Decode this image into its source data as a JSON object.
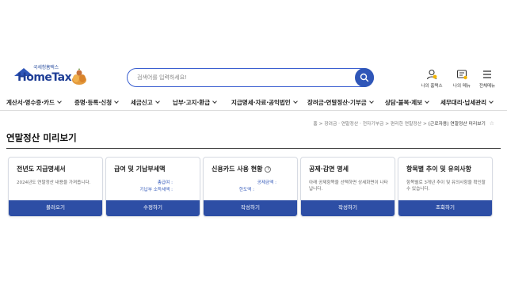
{
  "logo": {
    "sub": "국세청홈택스",
    "main": "HomeTax"
  },
  "search": {
    "placeholder": "검색어를 입력하세요!"
  },
  "utils": [
    {
      "label": "나의 홈택스",
      "icon": "user-icon"
    },
    {
      "label": "나의 메뉴",
      "icon": "my-menu-icon"
    },
    {
      "label": "전체메뉴",
      "icon": "hamburger-menu-icon"
    }
  ],
  "nav": [
    "계산서·영수증·카드",
    "증명·등록·신청",
    "세금신고",
    "납부·고지·환급",
    "지급명세·자료·공익법인",
    "장려금·연말정산·기부금",
    "상담·불복·제보",
    "세무대리·납세관리"
  ],
  "breadcrumb": {
    "items": [
      "홈",
      "장려금 · 연말정산 · 전자기부금",
      "편리한 연말정산"
    ],
    "current": "(근로자용) 연말정산 미리보기"
  },
  "page_title": "연말정산 미리보기",
  "cards": [
    {
      "title": "전년도 지급명세서",
      "desc": "2024년도 연말정산 내용을 가져옵니다.",
      "button": "불러오기"
    },
    {
      "title": "급여 및 기납부세액",
      "kv": [
        "총급여 :",
        "기납부 소득세액 :"
      ],
      "button": "수정하기"
    },
    {
      "title": "신용카드 사용 현황",
      "help": "?",
      "kv": [
        "공제금액 :",
        "한도액 :"
      ],
      "button": "작성하기"
    },
    {
      "title": "공제·감면 명세",
      "desc": "아래 공제항목을 선택하면 상세화면이 나타납니다.",
      "button": "작성하기"
    },
    {
      "title": "항목별 추이 및 유의사항",
      "desc": "항목별로 3개년 추이 및 유의사항을 확인할 수 있습니다.",
      "button": "조회하기"
    }
  ],
  "colors": {
    "primary": "#2d4ea5",
    "accent": "#3a5fd0"
  }
}
